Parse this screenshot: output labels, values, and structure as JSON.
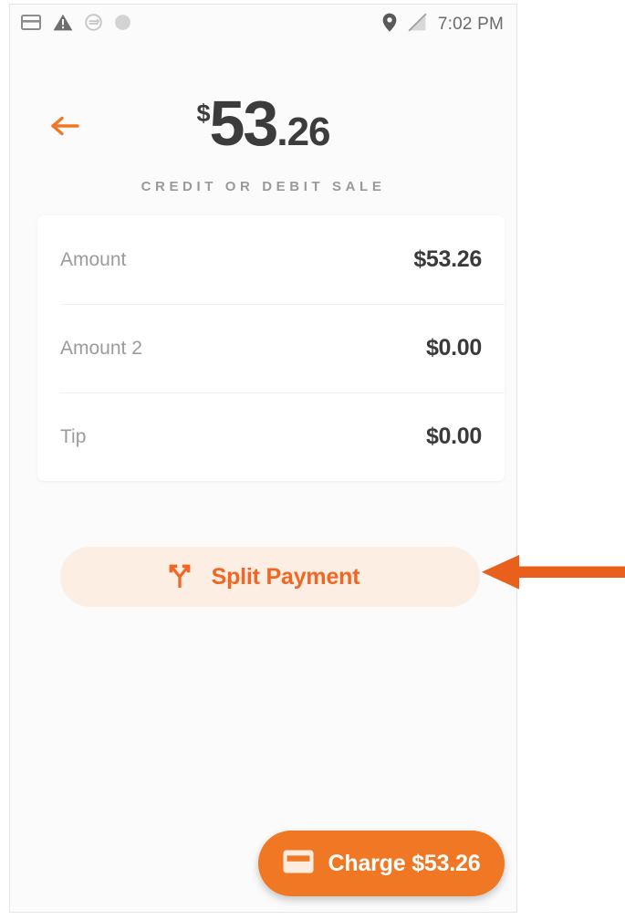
{
  "status_bar": {
    "icons_left": [
      "credit-card-icon",
      "warning-triangle-icon",
      "sync-circle-icon",
      "filled-circle-icon"
    ],
    "icons_right": [
      "location-pin-icon",
      "signal-off-icon"
    ],
    "time": "7:02 PM"
  },
  "header": {
    "back_icon": "back-arrow-icon",
    "amount": {
      "currency": "$",
      "whole": "53",
      "cents": ".26"
    },
    "sale_type": "CREDIT OR DEBIT SALE"
  },
  "amount_card": {
    "rows": [
      {
        "label": "Amount",
        "value": "$53.26"
      },
      {
        "label": "Amount 2",
        "value": "$0.00"
      },
      {
        "label": "Tip",
        "value": "$0.00"
      }
    ]
  },
  "split_payment": {
    "label": "Split Payment",
    "icon": "call-split-icon"
  },
  "charge": {
    "label": "Charge $53.26",
    "icon": "credit-card-icon"
  },
  "annotation": {
    "type": "left-pointing-arrow",
    "target": "split-payment-button"
  },
  "colors": {
    "accent_orange": "#F07723",
    "split_button_bg": "#FDEEE3",
    "split_text": "#F26522",
    "screen_bg": "#FBFBFB",
    "card_bg": "#FFFFFF",
    "label_gray": "#9B9B9B",
    "value_dark": "#3A3A3A",
    "status_gray": "#6B6B6B",
    "annotation_orange": "#E8601C"
  }
}
